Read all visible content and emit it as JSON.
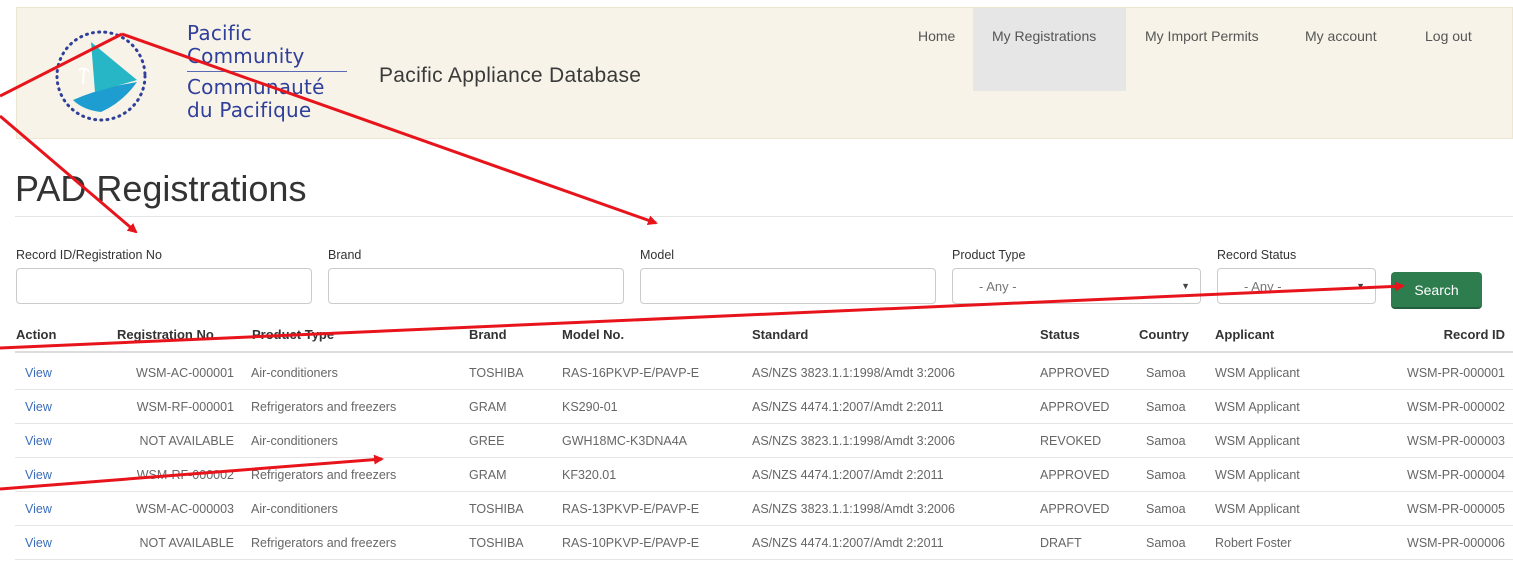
{
  "logo": {
    "line1": "Pacific",
    "line2": "Community",
    "line3": "Communauté",
    "line4": "du Pacifique"
  },
  "site_title": "Pacific Appliance Database",
  "nav": [
    {
      "label": "Home"
    },
    {
      "label": "My Registrations"
    },
    {
      "label": "My Import Permits"
    },
    {
      "label": "My account"
    },
    {
      "label": "Log out"
    }
  ],
  "page_title": "PAD Registrations",
  "filters": {
    "record_id_label": "Record ID/Registration No",
    "brand_label": "Brand",
    "model_label": "Model",
    "product_type_label": "Product Type",
    "product_type_value": "- Any -",
    "record_status_label": "Record Status",
    "record_status_value": "- Any -",
    "search_label": "Search"
  },
  "table": {
    "headers": {
      "action": "Action",
      "registration_no": "Registration No.",
      "product_type": "Product Type",
      "brand": "Brand",
      "model_no": "Model No.",
      "standard": "Standard",
      "status": "Status",
      "country": "Country",
      "applicant": "Applicant",
      "record_id": "Record ID"
    },
    "rows": [
      {
        "action": "View",
        "registration_no": "WSM-AC-000001",
        "product_type": "Air-conditioners",
        "brand": "TOSHIBA",
        "model_no": "RAS-16PKVP-E/PAVP-E",
        "standard": "AS/NZS 3823.1.1:1998/Amdt 3:2006",
        "status": "APPROVED",
        "country": "Samoa",
        "applicant": "WSM Applicant",
        "record_id": "WSM-PR-000001"
      },
      {
        "action": "View",
        "registration_no": "WSM-RF-000001",
        "product_type": "Refrigerators and freezers",
        "brand": "GRAM",
        "model_no": "KS290-01",
        "standard": "AS/NZS 4474.1:2007/Amdt 2:2011",
        "status": "APPROVED",
        "country": "Samoa",
        "applicant": "WSM Applicant",
        "record_id": "WSM-PR-000002"
      },
      {
        "action": "View",
        "registration_no": "NOT AVAILABLE",
        "product_type": "Air-conditioners",
        "brand": "GREE",
        "model_no": "GWH18MC-K3DNA4A",
        "standard": "AS/NZS 3823.1.1:1998/Amdt 3:2006",
        "status": "REVOKED",
        "country": "Samoa",
        "applicant": "WSM Applicant",
        "record_id": "WSM-PR-000003"
      },
      {
        "action": "View",
        "registration_no": "WSM-RF-000002",
        "product_type": "Refrigerators and freezers",
        "brand": "GRAM",
        "model_no": "KF320.01",
        "standard": "AS/NZS 4474.1:2007/Amdt 2:2011",
        "status": "APPROVED",
        "country": "Samoa",
        "applicant": "WSM Applicant",
        "record_id": "WSM-PR-000004"
      },
      {
        "action": "View",
        "registration_no": "WSM-AC-000003",
        "product_type": "Air-conditioners",
        "brand": "TOSHIBA",
        "model_no": "RAS-13PKVP-E/PAVP-E",
        "standard": "AS/NZS 3823.1.1:1998/Amdt 3:2006",
        "status": "APPROVED",
        "country": "Samoa",
        "applicant": "WSM Applicant",
        "record_id": "WSM-PR-000005"
      },
      {
        "action": "View",
        "registration_no": "NOT AVAILABLE",
        "product_type": "Refrigerators and freezers",
        "brand": "TOSHIBA",
        "model_no": "RAS-10PKVP-E/PAVP-E",
        "standard": "AS/NZS 4474.1:2007/Amdt 2:2011",
        "status": "DRAFT",
        "country": "Samoa",
        "applicant": "Robert Foster",
        "record_id": "WSM-PR-000006"
      }
    ]
  },
  "colors": {
    "header_bg": "#f7f3e8",
    "brand_blue": "#2f3f9a",
    "link_blue": "#3a6db8",
    "search_green": "#2e7d4f",
    "annotation_red": "#e8141c"
  },
  "icons": {
    "logo": "pacific-community-emblem-icon",
    "select_arrow": "caret-down-icon"
  }
}
